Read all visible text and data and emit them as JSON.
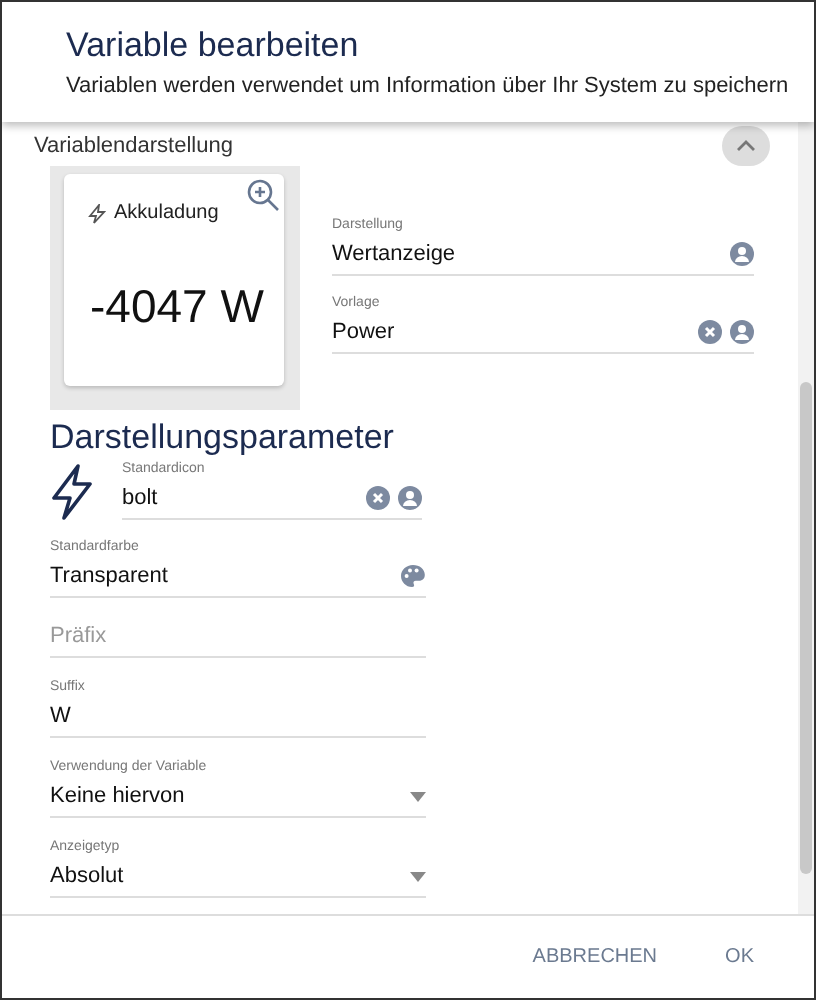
{
  "dialog": {
    "title": "Variable bearbeiten",
    "subtitle": "Variablen werden verwendet um Information über Ihr System zu speichern"
  },
  "section": {
    "title": "Variablendarstellung",
    "expanded": true
  },
  "preview": {
    "name": "Akkuladung",
    "value": "-4047 W"
  },
  "display_fields": [
    {
      "label": "Darstellung",
      "value": "Wertanzeige",
      "actions": [
        {
          "kind": "pick"
        }
      ]
    },
    {
      "label": "Vorlage",
      "value": "Power",
      "actions": [
        {
          "kind": "clear"
        },
        {
          "kind": "pick"
        }
      ]
    }
  ],
  "parameters": {
    "title": "Darstellungsparameter",
    "icon_field": {
      "label": "Standardicon",
      "value": "bolt",
      "actions": [
        {
          "kind": "clear"
        },
        {
          "kind": "pick"
        }
      ]
    },
    "fields": [
      {
        "kind": "text",
        "label": "Standardfarbe",
        "value": "Transparent",
        "actions": [
          {
            "kind": "palette"
          }
        ]
      },
      {
        "kind": "text",
        "placeholder": "Präfix"
      },
      {
        "kind": "text",
        "label": "Suffix",
        "value": "W"
      },
      {
        "kind": "select",
        "label": "Verwendung der Variable",
        "value": "Keine hiervon"
      },
      {
        "kind": "select",
        "label": "Anzeigetyp",
        "value": "Absolut"
      }
    ]
  },
  "buttons": [
    "ABBRECHEN",
    "OK"
  ]
}
